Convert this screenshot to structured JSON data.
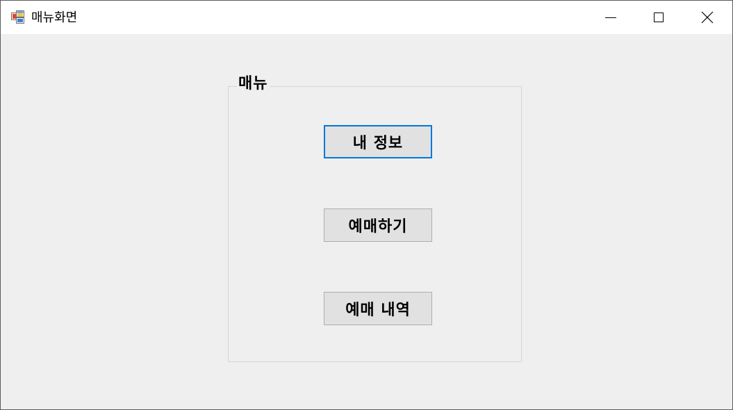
{
  "window": {
    "title": "매뉴화면",
    "icon": "winforms-app-icon",
    "controls": {
      "minimize_icon": "minimize-icon",
      "maximize_icon": "maximize-icon",
      "close_icon": "close-icon"
    }
  },
  "group": {
    "label": "매뉴"
  },
  "buttons": {
    "my_info": "내 정보",
    "booking": "예매하기",
    "booking_history": "예매 내역"
  },
  "colors": {
    "focus_border": "#0078d7",
    "button_face": "#e1e1e1",
    "client_background": "#efefef",
    "titlebar_background": "#ffffff"
  }
}
